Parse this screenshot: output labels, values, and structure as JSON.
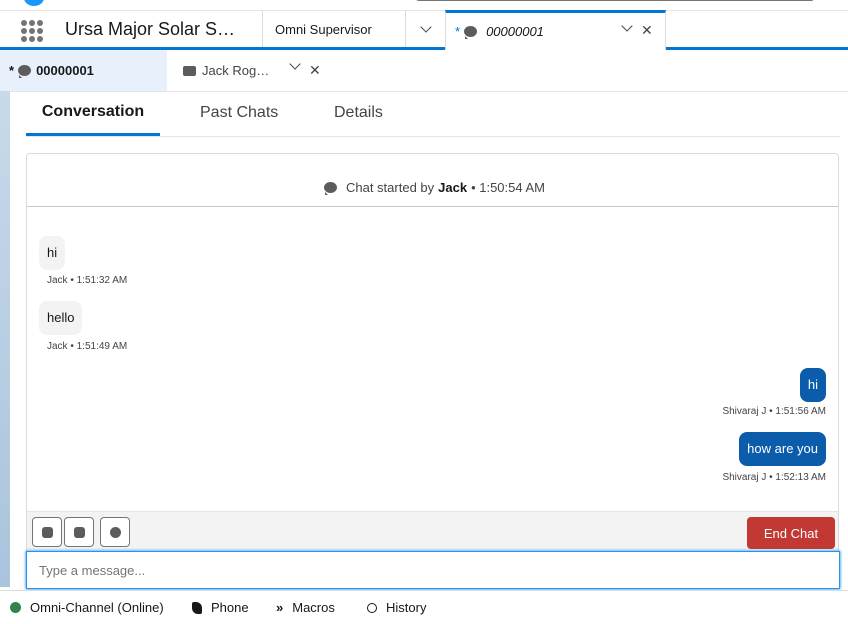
{
  "app": {
    "name": "Ursa Major Solar S…"
  },
  "nav_tabs": {
    "omni_label": "Omni Supervisor",
    "active_prefix": "*",
    "active_label": "00000001"
  },
  "sub_tabs": {
    "tab1_prefix": "*",
    "tab1_label": "00000001",
    "tab2_label": "Jack Rog…"
  },
  "record_tabs": [
    "Conversation",
    "Past Chats",
    "Details"
  ],
  "chat": {
    "header_prefix": "Chat started by",
    "header_name": "Jack",
    "header_time": "• 1:50:54 AM",
    "messages": [
      {
        "text": "hi",
        "meta": "Jack • 1:51:32 AM",
        "dir": "in"
      },
      {
        "text": "hello",
        "meta": "Jack • 1:51:49 AM",
        "dir": "in"
      },
      {
        "text": "hi",
        "meta": "Shivaraj J • 1:51:56 AM",
        "dir": "out"
      },
      {
        "text": "how are you",
        "meta": "Shivaraj J • 1:52:13 AM",
        "dir": "out"
      }
    ],
    "end_chat_label": "End Chat",
    "composer_placeholder": "Type a message..."
  },
  "utility_bar": {
    "omni": "Omni-Channel (Online)",
    "phone": "Phone",
    "macros": "Macros",
    "history": "History"
  },
  "colors": {
    "brand": "#0176d3",
    "outgoing_bubble": "#0b5cab",
    "incoming_bubble": "#f3f3f3",
    "end_chat": "#c23934",
    "online": "#2e844a"
  },
  "icons": [
    "app-launcher-icon",
    "chat-bubble-icon",
    "contact-card-icon",
    "chevron-down-icon",
    "close-icon",
    "phone-icon",
    "macros-icon",
    "history-icon"
  ]
}
